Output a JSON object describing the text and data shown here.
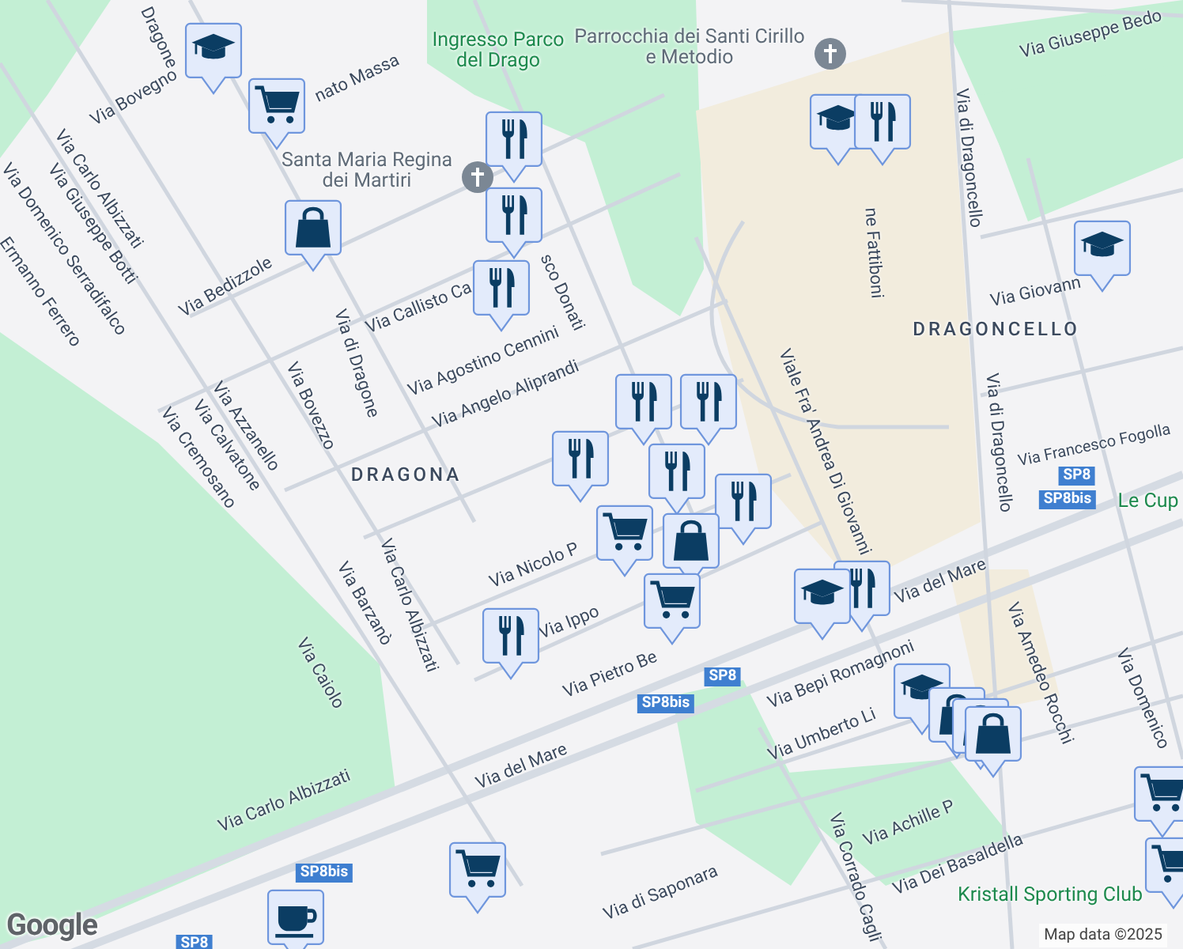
{
  "map": {
    "labels": [
      {
        "kind": "street",
        "text": "Dragone"
      },
      {
        "kind": "street",
        "text": "Via Bovegno"
      },
      {
        "kind": "street",
        "text": "nato Massa"
      },
      {
        "kind": "street",
        "text": "Via Carlo Albizzati"
      },
      {
        "kind": "street",
        "text": "Via Giuseppe Botti"
      },
      {
        "kind": "street",
        "text": "Via Domenico Serradifalco"
      },
      {
        "kind": "street",
        "text": "Ermanno Ferrero"
      },
      {
        "kind": "street",
        "text": "Via Bedizzole"
      },
      {
        "kind": "street",
        "text": "Via Callisto Ca"
      },
      {
        "kind": "street",
        "text": "sco Donati"
      },
      {
        "kind": "street",
        "text": "Via Agostino Cennini"
      },
      {
        "kind": "street",
        "text": "Via Angelo Aliprandi"
      },
      {
        "kind": "street",
        "text": "Via di Dragone"
      },
      {
        "kind": "street",
        "text": "Via Bovezzo"
      },
      {
        "kind": "street",
        "text": "Via Azzanello"
      },
      {
        "kind": "street",
        "text": "Via Calvatone"
      },
      {
        "kind": "street",
        "text": "Via Cremosano"
      },
      {
        "kind": "district",
        "text": "DRAGONA"
      },
      {
        "kind": "street",
        "text": "Via Nicolo P"
      },
      {
        "kind": "street",
        "text": "Via Ippo"
      },
      {
        "kind": "street",
        "text": "Via Pietro Be"
      },
      {
        "kind": "street",
        "text": "Via Barzanò"
      },
      {
        "kind": "street",
        "text": "Via Carlo Albizzati"
      },
      {
        "kind": "street",
        "text": "Via Caiolo"
      },
      {
        "kind": "street",
        "text": "Via Carlo Albizzati"
      },
      {
        "kind": "street",
        "text": "Via del Mare"
      },
      {
        "kind": "street",
        "text": "Via del Mare"
      },
      {
        "kind": "street",
        "text": "Viale Fra' Andrea Di Giovanni"
      },
      {
        "kind": "street",
        "text": "Via Bepi Romagnoni"
      },
      {
        "kind": "street",
        "text": "Via Umberto Li"
      },
      {
        "kind": "street",
        "text": "Via Achille P"
      },
      {
        "kind": "street",
        "text": "Via Dei Basaldella"
      },
      {
        "kind": "street",
        "text": "Via di Saponara"
      },
      {
        "kind": "street",
        "text": "Via Corrado Cagli"
      },
      {
        "kind": "street",
        "text": "Via Amedeo Rocchi"
      },
      {
        "kind": "street",
        "text": "Via Domenico"
      },
      {
        "kind": "street",
        "text": "Via di Dragoncello"
      },
      {
        "kind": "street",
        "text": "Via di Dragoncello"
      },
      {
        "kind": "street",
        "text": "Via Giuseppe Bedo"
      },
      {
        "kind": "street",
        "text": "Via Giovann"
      },
      {
        "kind": "district",
        "text": "DRAGONCELLO"
      },
      {
        "kind": "street",
        "text": "Via Francesco Fogolla"
      },
      {
        "kind": "street",
        "text": "ne Fattiboni"
      },
      {
        "kind": "park",
        "text": "Ingresso Parco del Drago"
      },
      {
        "kind": "church",
        "text": "Parrocchia dei Santi Cirillo e Metodio"
      },
      {
        "kind": "church",
        "text": "Santa Maria Regina dei Martiri"
      },
      {
        "kind": "park",
        "text": "Le Cup"
      },
      {
        "kind": "park",
        "text": "Kristall Sporting Club"
      },
      {
        "kind": "shield",
        "text": "SP8"
      },
      {
        "kind": "shield",
        "text": "SP8bis"
      },
      {
        "kind": "shield",
        "text": "SP8"
      },
      {
        "kind": "shield",
        "text": "SP8bis"
      },
      {
        "kind": "shield",
        "text": "SP8bis"
      },
      {
        "kind": "shield",
        "text": "SP8"
      }
    ],
    "markers": [
      {
        "kind": "school"
      },
      {
        "kind": "grocery"
      },
      {
        "kind": "shop"
      },
      {
        "kind": "restaurant"
      },
      {
        "kind": "restaurant"
      },
      {
        "kind": "restaurant"
      },
      {
        "kind": "school"
      },
      {
        "kind": "restaurant"
      },
      {
        "kind": "school"
      },
      {
        "kind": "restaurant"
      },
      {
        "kind": "restaurant"
      },
      {
        "kind": "restaurant"
      },
      {
        "kind": "restaurant"
      },
      {
        "kind": "restaurant"
      },
      {
        "kind": "shop"
      },
      {
        "kind": "grocery"
      },
      {
        "kind": "grocery"
      },
      {
        "kind": "restaurant"
      },
      {
        "kind": "school"
      },
      {
        "kind": "restaurant"
      },
      {
        "kind": "school"
      },
      {
        "kind": "shop"
      },
      {
        "kind": "shop"
      },
      {
        "kind": "shop"
      },
      {
        "kind": "grocery"
      },
      {
        "kind": "cafe"
      },
      {
        "kind": "grocery"
      },
      {
        "kind": "grocery"
      }
    ],
    "logo": "Google",
    "attribution": "Map data ©2025"
  }
}
